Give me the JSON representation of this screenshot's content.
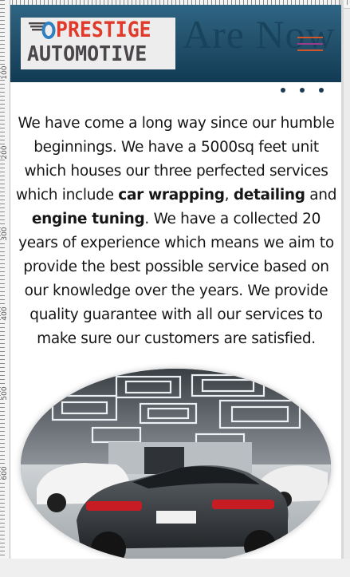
{
  "header": {
    "logo_line1": "PRESTIGE",
    "logo_line2": "AUTOMOTIVE",
    "hero_text": "Are Now",
    "menu_icon": "hamburger-menu-icon",
    "colors": {
      "header_bg": "#25546f",
      "logo_red": "#e03b2a",
      "logo_blue": "#2f7fc1",
      "logo_dark": "#4a4649",
      "menu_accent": "#d2552c"
    }
  },
  "carousel": {
    "dot_count": 3
  },
  "intro": {
    "part1": "We have come a long way since our humble beginnings. We have a 5000sq feet unit which houses our three perfected services which include ",
    "service1": "car wrapping",
    "sep1": ", ",
    "service2": "detailing",
    "sep2": " and ",
    "service3": "engine tuning",
    "part2": ". We have a collected 20 years of experience which means we aim to provide the best possible service based on our knowledge over the years. We provide quality guarantee with all our services to make sure our customers are satisfied."
  },
  "ruler": {
    "labels": [
      "100",
      "200",
      "300",
      "400",
      "500",
      "600"
    ]
  }
}
